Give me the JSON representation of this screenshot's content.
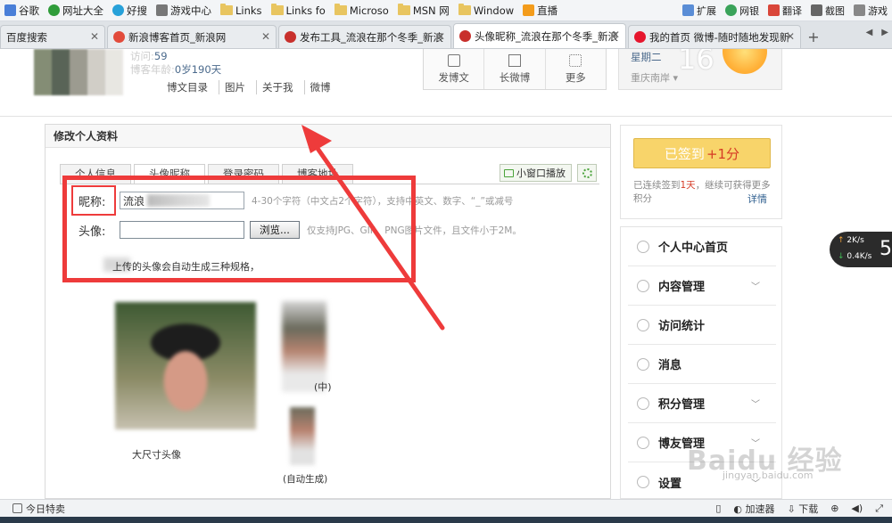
{
  "bookmarks": [
    {
      "label": "谷歌",
      "icon": "google-icon",
      "color": "#4a7fd8"
    },
    {
      "label": "网址大全",
      "icon": "globe-icon",
      "color": "#2f9c3a"
    },
    {
      "label": "好搜",
      "icon": "search-icon",
      "color": "#27a1d9"
    },
    {
      "label": "游戏中心",
      "icon": "gamepad-icon",
      "color": "#666666"
    },
    {
      "label": "Links",
      "icon": "folder-icon"
    },
    {
      "label": "Links fo",
      "icon": "folder-icon"
    },
    {
      "label": "Microso",
      "icon": "folder-icon"
    },
    {
      "label": "MSN 网",
      "icon": "folder-icon"
    },
    {
      "label": "Window",
      "icon": "folder-icon"
    },
    {
      "label": "直播",
      "icon": "live-icon",
      "color": "#f39c1c"
    }
  ],
  "toolbar_right": [
    "扩展",
    "网银",
    "翻译",
    "截图",
    "游戏"
  ],
  "tabs": [
    {
      "label": "百度搜索",
      "active": false
    },
    {
      "label": "新浪博客首页_新浪网",
      "active": false
    },
    {
      "label": "发布工具_流浪在那个冬季_新浪",
      "active": false
    },
    {
      "label": "头像昵称_流浪在那个冬季_新浪",
      "active": true
    },
    {
      "label": "我的首页 微博-随时随地发现新",
      "active": false
    }
  ],
  "header": {
    "visits_label": "访问:",
    "visits_value": "59",
    "age_label": "博客年龄:",
    "age_value": "0岁190天",
    "links": [
      "博文目录",
      "图片",
      "关于我",
      "微博"
    ],
    "tools": [
      "发博文",
      "长微博",
      "更多"
    ],
    "weekday": "星期二",
    "city": "重庆南岸",
    "temperature": "16"
  },
  "edit_panel": {
    "title": "修改个人资料",
    "tabs": [
      "个人信息",
      "头像昵称",
      "登录密码",
      "博客地址"
    ],
    "active_tab": 1,
    "mini_window": "小窗口播放",
    "nickname_label": "昵称:",
    "nickname_value": "流浪",
    "nickname_hint": "4-30个字符（中文占2个字符），支持中英文、数字、“_”或减号",
    "avatar_label": "头像:",
    "browse_label": "浏览...",
    "avatar_hint": "仅支持JPG、GIF、PNG图片文件，且文件小于2M。",
    "auto_note": "上传的头像会自动生成三种规格，",
    "big_caption": "大尺寸头像",
    "mid_caption": "(中)",
    "small_caption": "(自动生成)"
  },
  "checkin": {
    "button_label": "已签到",
    "bonus": "+1分",
    "text_prefix": "已连续签到",
    "days": "1天",
    "text_suffix": "，继续可获得更多积分",
    "detail": "详情"
  },
  "side_menu": [
    {
      "label": "个人中心首页",
      "caret": false
    },
    {
      "label": "内容管理",
      "caret": true
    },
    {
      "label": "访问统计",
      "caret": false
    },
    {
      "label": "消息",
      "caret": false
    },
    {
      "label": "积分管理",
      "caret": true
    },
    {
      "label": "博友管理",
      "caret": true
    },
    {
      "label": "设置",
      "caret": true
    }
  ],
  "speed": {
    "up": "2K/s",
    "down": "0.4K/s",
    "badge": "5"
  },
  "status": {
    "left": "今日特卖",
    "right": [
      "加速器",
      "下载"
    ]
  },
  "watermark": {
    "text": "Baidu 经验",
    "url": "jingyan.baidu.com"
  },
  "colors": {
    "highlight_box": "#ee3b3b",
    "checkin_button": "#f8d46a",
    "accent_link": "#2f5f8f"
  }
}
